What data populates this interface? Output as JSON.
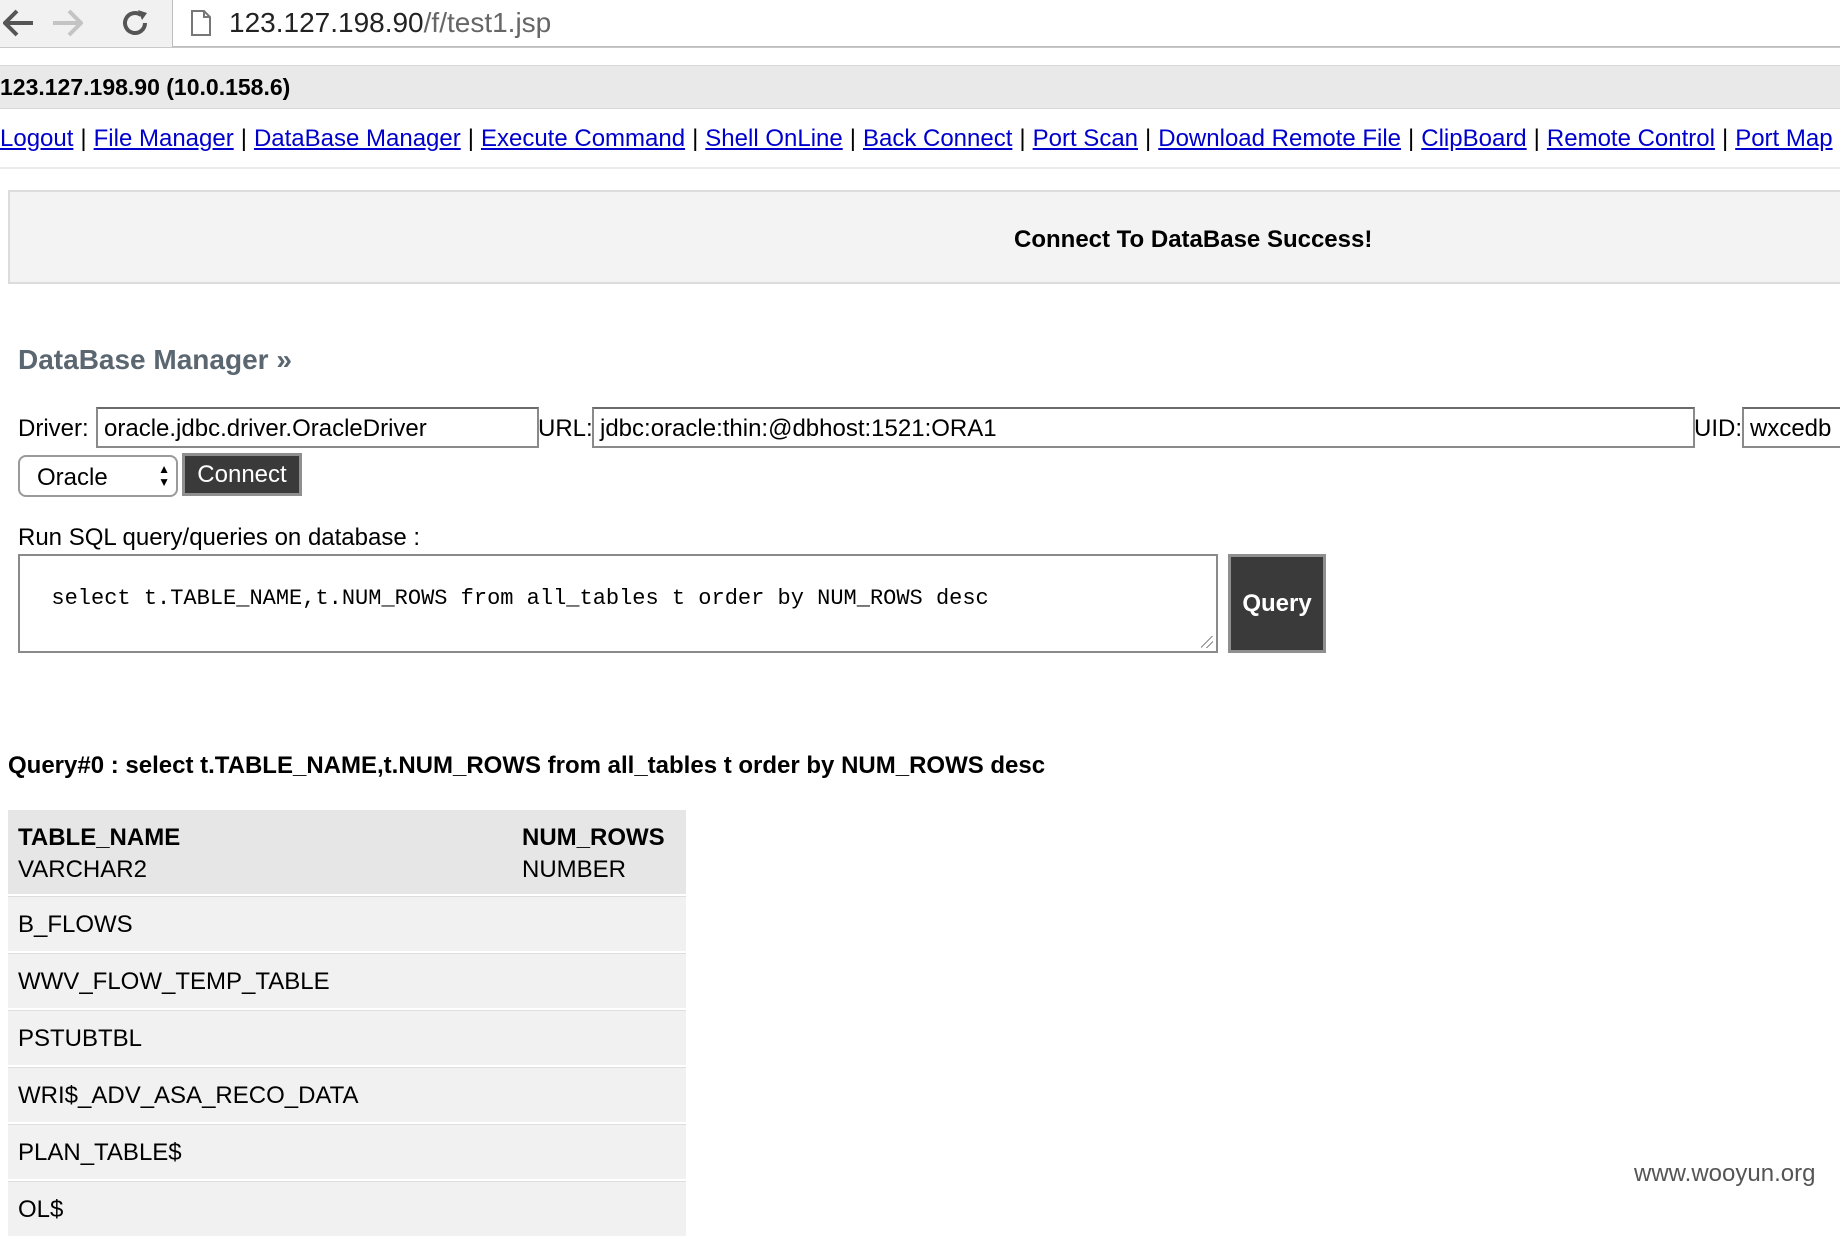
{
  "browser": {
    "url_host": "123.127.198.90",
    "url_path": "/f/test1.jsp"
  },
  "host_info": "123.127.198.90 (10.0.158.6)",
  "menu": [
    "Logout",
    "File Manager",
    "DataBase Manager",
    "Execute Command",
    "Shell OnLine",
    "Back Connect",
    "Port Scan",
    "Download Remote File",
    "ClipBoard",
    "Remote Control",
    "Port Map"
  ],
  "menu_separator": "|",
  "alert_message": "Connect To DataBase Success!",
  "section_title": "DataBase Manager »",
  "form": {
    "driver_label": "Driver:",
    "driver_value": "oracle.jdbc.driver.OracleDriver",
    "url_label": "URL:",
    "url_value": "jdbc:oracle:thin:@dbhost:1521:ORA1",
    "uid_label": "UID:",
    "uid_value": "wxcedb",
    "db_type": "Oracle",
    "connect_label": "Connect",
    "run_label": "Run SQL query/queries on database :",
    "sql": "select t.TABLE_NAME,t.NUM_ROWS from all_tables t order by NUM_ROWS desc",
    "query_label": "Query"
  },
  "result": {
    "title": "Query#0 : select t.TABLE_NAME,t.NUM_ROWS from all_tables t order by NUM_ROWS desc",
    "columns": [
      {
        "name": "TABLE_NAME",
        "type": "VARCHAR2"
      },
      {
        "name": "NUM_ROWS",
        "type": "NUMBER"
      }
    ],
    "rows": [
      "B_FLOWS",
      "WWV_FLOW_TEMP_TABLE",
      "PSTUBTBL",
      "WRI$_ADV_ASA_RECO_DATA",
      "PLAN_TABLE$",
      "OL$"
    ]
  },
  "watermark": "www.wooyun.org"
}
